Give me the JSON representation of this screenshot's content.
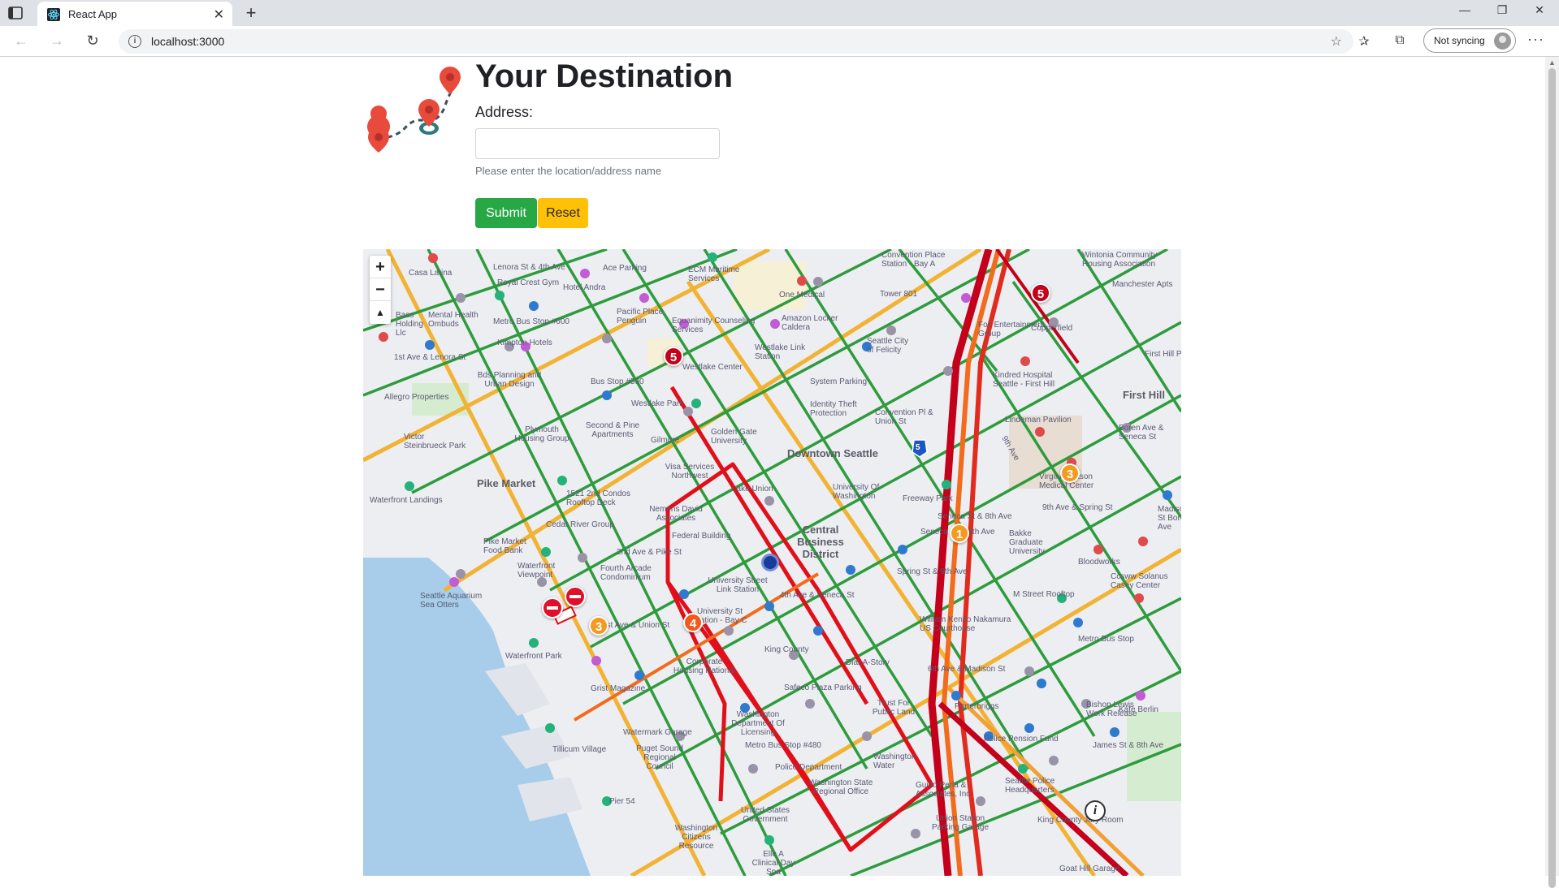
{
  "browser": {
    "tab_title": "React App",
    "url": "localhost:3000",
    "sync_label": "Not syncing"
  },
  "page": {
    "title": "Your Destination",
    "address_label": "Address:",
    "address_value": "",
    "help_text": "Please enter the location/address name",
    "submit_label": "Submit",
    "reset_label": "Reset"
  },
  "map": {
    "zoom_in": "+",
    "zoom_out": "−",
    "compass": "▲",
    "labels": {
      "downtown": "Downtown Seattle",
      "cbd": "Central Business District",
      "pike": "Pike Market",
      "first_hill": "First Hill",
      "casa_latina": "Casa Latina",
      "royal_crest": "Royal Crest Gym",
      "lenora": "Lenora St & 4th Ave",
      "hotel_andra": "Hotel Andra",
      "acc_parking": "Ace Parking",
      "ecm": "ECM Maritime Services",
      "one_medical": "One Medical",
      "convention_place": "Convention Place Station - Bay A",
      "wintonia": "Wintonia Community Housing Association",
      "manchester": "Manchester Apts",
      "copperfield": "Copperfield",
      "first_hill_park": "First Hill P",
      "westlake_link": "Westlake Link Station",
      "westlake_park": "Westlake Park",
      "westlake_center": "Westlake Center",
      "system_parking": "System Parking",
      "bus_590": "Bus Stop #590",
      "pacific_place": "Pacific Place Penguin",
      "equanimity": "Equanimity Counseling Services",
      "amazon": "Amazon Locker Caldera",
      "seattle_city": "Seattle City of Felicity",
      "kindred": "Kindred Hospital Seattle - First Hill",
      "lindeman": "Lindeman Pavilion",
      "virginia": "Virginia Mason Medical Center",
      "boren": "Boren Ave & Seneca St",
      "golden_gate": "Golden Gate University",
      "university_wa": "University Of Washington",
      "lake_union": "Lake Union",
      "freeway_park": "Freeway Park",
      "seneca_8th": "Seneca St & 8th Ave",
      "seneca_6th": "Seneca St & 6th Ave",
      "bakke": "Bakke Graduate University",
      "bloodworks": "Bloodworks",
      "ccsww": "Ccsww Solanus Casey Center",
      "m_street": "M Street Rooftop",
      "metro_bus": "Metro Bus Stop",
      "bishop_lewis": "Bishop Lewis Work Release",
      "kafe_berlin": "Kafe Berlin",
      "james_8th": "James St & 8th Ave",
      "waterfront_landings": "Waterfront Landings",
      "victor": "Victor Steinbrueck Park",
      "cedar_river": "Cedar River Group",
      "pike_food": "Pike Market Food Bank",
      "aquarium": "Seattle Aquarium Sea Otters",
      "waterfront_park": "Waterfront Park",
      "grist": "Grist Magazine",
      "tillicum": "Tillicum Village",
      "pier54": "Pier 54",
      "waterfront_viewpoint": "Waterfront Viewpoint",
      "ave_union": "1st Ave & Union St",
      "univ_street": "University Street Link Station",
      "univ_st_bay": "University St Station - Bay C",
      "ave4_seneca": "4th Ave & Seneca St",
      "king_county": "King County",
      "dial_a_story": "Dial-A-Story",
      "safeco": "Safeco Plaza Parking",
      "trust_public": "Trust For Public Land",
      "washington_dept": "Washington Department Of Licensing",
      "metro_480": "Metro Bus Stop #480",
      "police_dept": "Police Department",
      "wash_state": "Washington State Regional Office",
      "united_states": "United States Government",
      "washington_citizens": "Washington Citizens Resource",
      "elle": "Elle A Clinical Day Spa",
      "puget_sound": "Puget Sound Regional Council",
      "watermark": "Watermark Garage",
      "corporate": "Corporate Housing National",
      "federal": "Federal Building",
      "nemens": "Nemens David Associates",
      "visa": "Visa Services Northwest",
      "second_pine": "Second & Pine Apartments",
      "gilmore": "Gilmore",
      "plymouth": "Plymouth Housing Group",
      "bds": "Bds Planning and Urban Design",
      "allegro": "Allegro Properties",
      "kimpton": "Kimpton Hotels",
      "metro_600": "Metro Bus Stop #600",
      "mental_health": "Mental Health Ombuds",
      "bass": "Bass Holding Llc",
      "first_lenora": "1st Ave & Lenora St",
      "condo": "1521 2nd Condos Rooftop Deck",
      "second_pike": "2nd Ave & Pike St",
      "fourth_arcade": "Fourth Arcade Condominium",
      "spring_st": "Spring St & 9th Ave",
      "william_kenzo": "William Kenzo Nakamura US Courthouse",
      "sixth_madison": "6th Ave & Madison St",
      "porterbrigg": "Porterbriggs",
      "police_pension": "Police Pension Fund",
      "seattle_police": "Seattle Police Headquarters",
      "king_county_jury": "King County Jury Room",
      "union_station": "Union Station Parking Garage",
      "guido_perla": "Guido Perla & Associates, Inc.",
      "washington_water": "Washington Water",
      "goat_hill": "Goat Hill Garage",
      "ninth_spring": "9th Ave & Spring St",
      "identity_theft": "Identity Theft Protection",
      "convention_union": "Convention Pl & Union St",
      "tower_801": "Tower 801",
      "fox": "Fox Entertainment Group",
      "madison_st": "Madison St Boren Ave",
      "ninth_ave": "9th Ave",
      "i5": "5"
    },
    "incidents": [
      {
        "id": "i1",
        "label": "5",
        "kind": "red"
      },
      {
        "id": "i2",
        "label": "5",
        "kind": "red"
      },
      {
        "id": "i3",
        "label": "3",
        "kind": "orange"
      },
      {
        "id": "i4",
        "label": "1",
        "kind": "orange"
      },
      {
        "id": "i5",
        "label": "4",
        "kind": "or2"
      },
      {
        "id": "i6",
        "label": "3",
        "kind": "orange"
      }
    ]
  }
}
